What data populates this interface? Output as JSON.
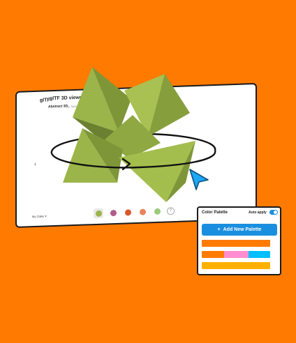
{
  "app": {
    "logo": "glTF",
    "title": "glTF 3D viewer",
    "subtitle": "Abstract 3D",
    "byline": "by Sant..."
  },
  "viewer": {
    "model_selector": "My Collec",
    "thumbnails": [
      {
        "name": "green-shape",
        "color": "#9CB54A",
        "selected": true
      },
      {
        "name": "purple-blob",
        "color": "#B05C8A",
        "selected": false
      },
      {
        "name": "orange-ball",
        "color": "#D9572B",
        "selected": false
      },
      {
        "name": "coral-shape",
        "color": "#E8855A",
        "selected": false
      },
      {
        "name": "mint-shape",
        "color": "#9CCB7A",
        "selected": false
      }
    ],
    "help": "?"
  },
  "palette": {
    "title": "Color Palette",
    "auto_apply_label": "Auto apply",
    "auto_apply": true,
    "add_button_label": "Add New Palette",
    "rows": [
      [
        {
          "color": "#FF7A00",
          "weight": 1
        }
      ],
      [
        {
          "color": "#FF7A00",
          "weight": 0.33
        },
        {
          "color": "#FF8ED0",
          "weight": 0.35
        },
        {
          "color": "#00BFFF",
          "weight": 0.32
        }
      ],
      [
        {
          "color": "#FFB000",
          "weight": 1
        }
      ]
    ]
  },
  "colors": {
    "background": "#FF7A00",
    "accent": "#1A8FE0",
    "shape": "#9CB54A",
    "cursor": "#1EA7F5"
  }
}
